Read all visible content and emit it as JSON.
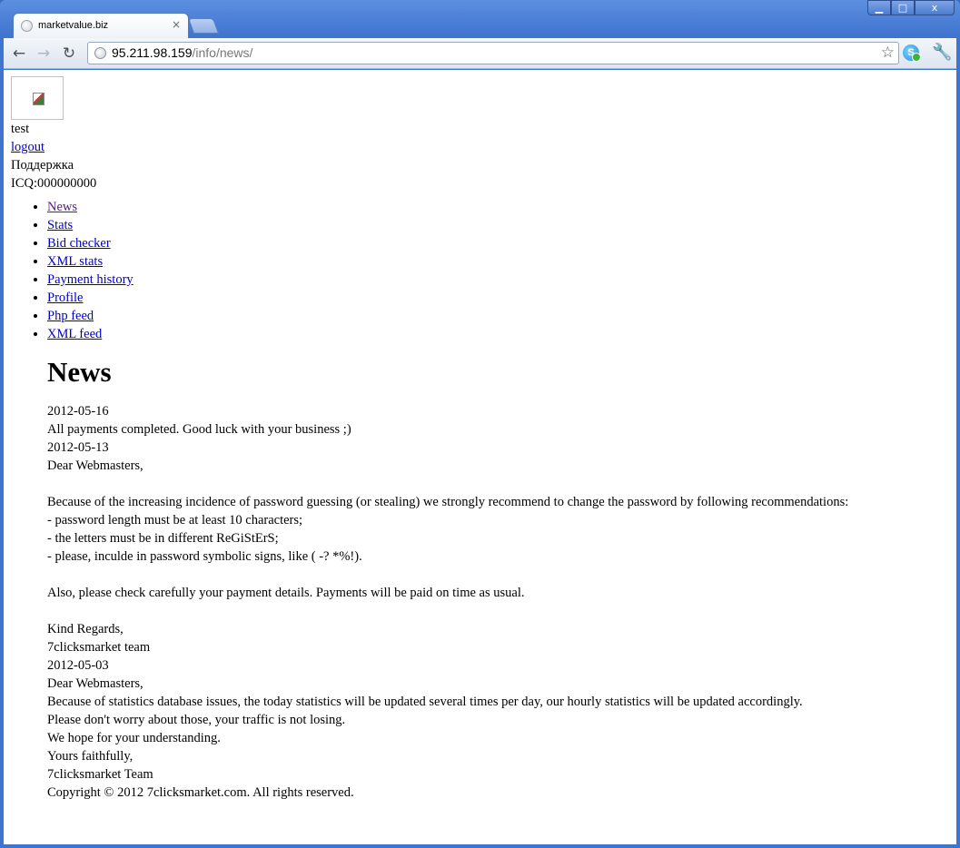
{
  "browser": {
    "tab_title": "marketvalue.biz",
    "tab_close": "×",
    "url_host": "95.211.98.159",
    "url_path": "/info/news/",
    "window_controls": {
      "minimize": "▁",
      "maximize": "□",
      "close": "x"
    },
    "nav": {
      "back": "←",
      "forward": "→",
      "reload": "↻",
      "star": "☆",
      "wrench": "🔧",
      "ext": "S"
    }
  },
  "user": {
    "name": "test",
    "logout": "logout",
    "support": "Поддержка",
    "icq": "ICQ:000000000"
  },
  "menu": [
    {
      "label": "News",
      "visited": true
    },
    {
      "label": "Stats"
    },
    {
      "label": "Bid checker"
    },
    {
      "label": "XML stats"
    },
    {
      "label": "Payment history"
    },
    {
      "label": "Profile"
    },
    {
      "label": "Php feed"
    },
    {
      "label": "XML feed"
    }
  ],
  "news": {
    "heading": "News",
    "lines": [
      "2012-05-16",
      "All payments completed. Good luck with your business ;)",
      "2012-05-13",
      "Dear Webmasters,",
      "",
      "Because of the increasing incidence of password guessing (or stealing) we strongly recommend to change the password by following recommendations:",
      "- password length must be at least 10 characters;",
      "- the letters must be in different ReGiStErS;",
      "- please, inculde in password symbolic signs, like ( -? *%!).",
      "",
      "Also, please check carefully your payment details. Payments will be paid on time as usual.",
      "",
      "Kind Regards,",
      "7clicksmarket team",
      "2012-05-03",
      "Dear Webmasters,",
      "Because of statistics database issues, the today statistics will be updated several times per day, our hourly statistics will be updated accordingly.",
      "Please don't worry about those, your traffic is not losing.",
      "We hope for your understanding.",
      "Yours faithfully,",
      "7clicksmarket Team"
    ],
    "copyright": "Copyright © 2012 7clicksmarket.com. All rights reserved."
  }
}
